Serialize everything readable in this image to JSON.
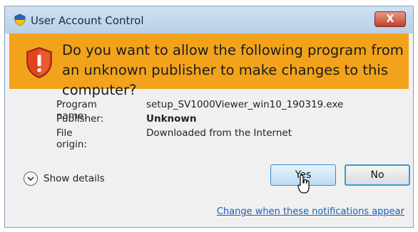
{
  "window": {
    "title": "User Account Control",
    "close_label": "X"
  },
  "banner": {
    "question": "Do you want to allow the following program from an unknown publisher to make changes to this computer?"
  },
  "details": {
    "program_label": "Program name:",
    "program_value": "setup_SV1000Viewer_win10_190319.exe",
    "publisher_label": "Publisher:",
    "publisher_value": "Unknown",
    "origin_label": "File origin:",
    "origin_value": "Downloaded from the Internet"
  },
  "show_details": {
    "label": "Show details"
  },
  "buttons": {
    "yes": "Yes",
    "no": "No"
  },
  "footer": {
    "link": "Change when these notifications appear"
  },
  "colors": {
    "banner": "#f2a31b",
    "titlebar": "#c4d9ee",
    "link": "#1a5fb4",
    "button_focus_border": "#3b9ad6"
  },
  "icons": {
    "title_shield": "uac-shield-icon",
    "warning_shield": "warning-shield-icon",
    "expand": "chevron-down-icon",
    "pointer": "hand-cursor-icon"
  }
}
